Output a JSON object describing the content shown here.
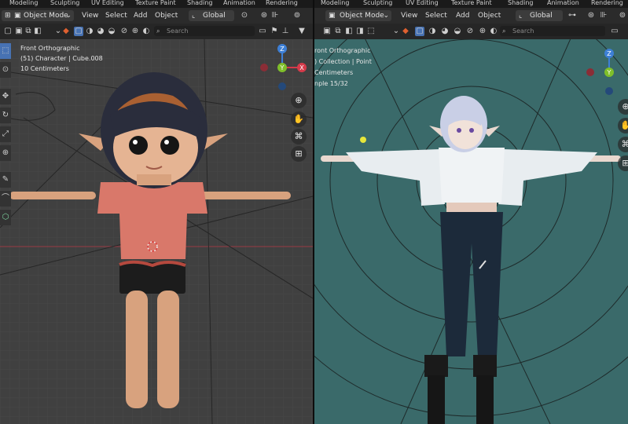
{
  "left": {
    "tabs": [
      "Modeling",
      "Sculpting",
      "UV Editing",
      "Texture Paint",
      "Shading",
      "Animation",
      "Rendering"
    ],
    "mode_label": "Object Mode",
    "menus": [
      "View",
      "Select",
      "Add",
      "Object"
    ],
    "orientation_label": "Global",
    "search_placeholder": "Search",
    "overlay": {
      "view_name": "Front Orthographic",
      "collection": "(51) Character | Cube.008",
      "scale": "10 Centimeters"
    }
  },
  "right": {
    "tabs": [
      "Modeling",
      "Sculpting",
      "UV Editing",
      "Texture Paint",
      "Shading",
      "Animation",
      "Rendering"
    ],
    "mode_label": "Object Mode",
    "menus": [
      "View",
      "Select",
      "Add",
      "Object"
    ],
    "orientation_label": "Global",
    "search_placeholder": "Search",
    "overlay": {
      "view_name": "ront Orthographic",
      "collection": ") Collection | Point",
      "scale": "Centimeters",
      "sample": "nple 15/32"
    }
  },
  "gizmo": {
    "z": "Z",
    "y": "Y",
    "x": "X"
  },
  "colors": {
    "left_viewport": "#404040",
    "right_viewport": "#3a6a6a",
    "gizmo_x": "#d63a4a",
    "gizmo_y": "#7fbf2a",
    "gizmo_z": "#3d7fd6",
    "active_tool": "#4772b3"
  },
  "icons": [
    "cursor-icon",
    "move-icon",
    "rotate-icon",
    "scale-icon",
    "transform-icon",
    "annotate-icon",
    "measure-icon",
    "add-cube-icon",
    "zoom-icon",
    "hand-icon",
    "camera-icon",
    "grid-icon"
  ]
}
